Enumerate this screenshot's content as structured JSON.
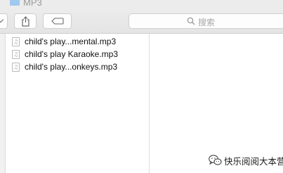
{
  "window": {
    "title": "MP3"
  },
  "toolbar": {
    "view_button_icon": "chevron-down-icon",
    "share_button_icon": "share-icon",
    "tag_button_icon": "tag-icon"
  },
  "search": {
    "placeholder": "搜索",
    "icon": "search-icon"
  },
  "files": [
    {
      "name": "child's play...mental.mp3",
      "icon": "audio-file-icon"
    },
    {
      "name": "child's play Karaoke.mp3",
      "icon": "audio-file-icon"
    },
    {
      "name": "child's play...onkeys.mp3",
      "icon": "audio-file-icon"
    }
  ],
  "watermark": {
    "text": "快乐阅阅大本营",
    "icon": "wechat-logo"
  }
}
